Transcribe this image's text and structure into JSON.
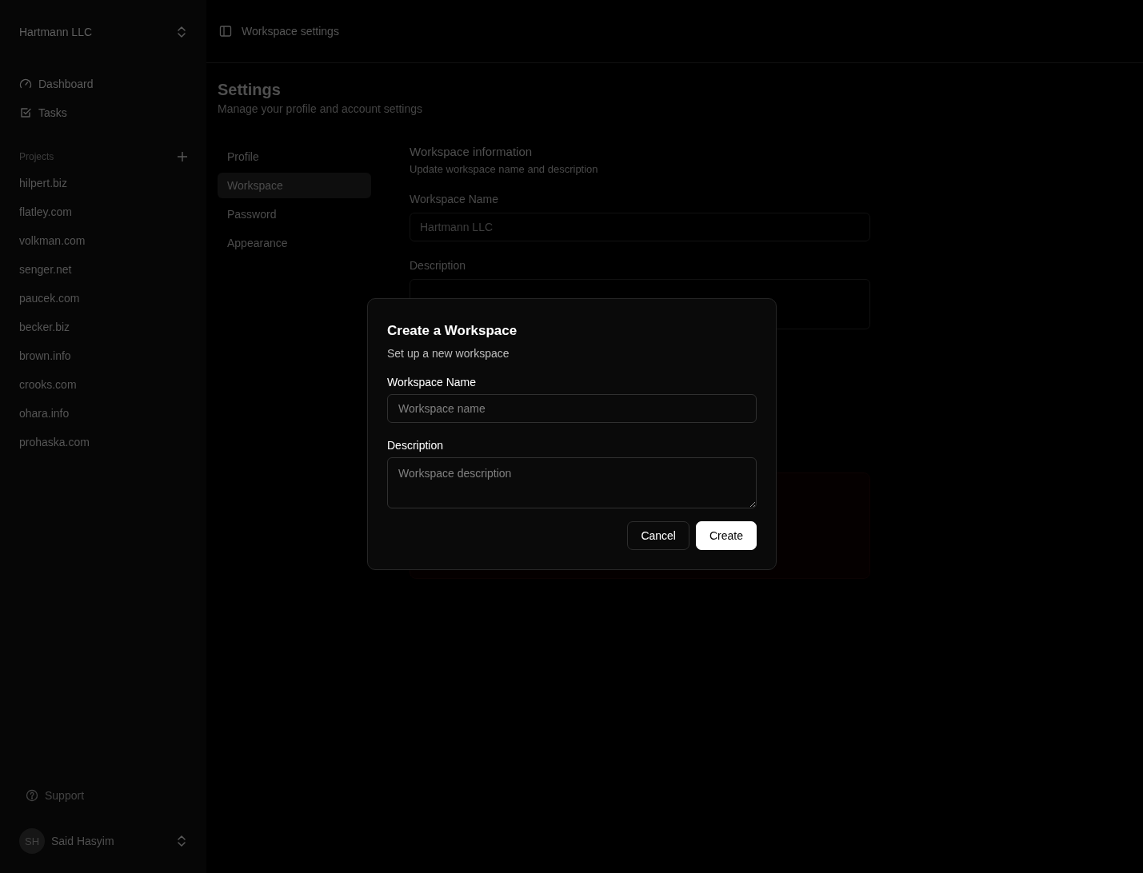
{
  "sidebar": {
    "workspace": {
      "name": "Hartmann LLC"
    },
    "nav": [
      {
        "kind": "dashboard",
        "label": "Dashboard"
      },
      {
        "kind": "tasks",
        "label": "Tasks"
      }
    ],
    "projects": {
      "title": "Projects",
      "items": [
        "hilpert.biz",
        "flatley.com",
        "volkman.com",
        "senger.net",
        "paucek.com",
        "becker.biz",
        "brown.info",
        "crooks.com",
        "ohara.info",
        "prohaska.com"
      ]
    },
    "support": {
      "label": "Support"
    },
    "user": {
      "initials": "SH",
      "name": "Said Hasyim"
    }
  },
  "header": {
    "title": "Workspace settings"
  },
  "settings": {
    "title": "Settings",
    "subtitle": "Manage your profile and account settings",
    "tabs": [
      {
        "label": "Profile",
        "selected": false
      },
      {
        "label": "Workspace",
        "selected": true
      },
      {
        "label": "Password",
        "selected": false
      },
      {
        "label": "Appearance",
        "selected": false
      }
    ],
    "section": {
      "title": "Workspace information",
      "subtitle": "Update workspace name and description",
      "fields": [
        {
          "kind": "input",
          "label": "Workspace Name",
          "value": "Hartmann LLC"
        },
        {
          "kind": "textarea",
          "label": "Description"
        }
      ]
    }
  },
  "dialog": {
    "title": "Create a Workspace",
    "subtitle": "Set up a new workspace",
    "fields": [
      {
        "kind": "input",
        "label": "Workspace Name",
        "placeholder": "Workspace name"
      },
      {
        "kind": "textarea",
        "label": "Description",
        "placeholder": "Workspace description"
      }
    ],
    "buttons": [
      {
        "kind": "secondary",
        "label": "Cancel"
      },
      {
        "kind": "primary",
        "label": "Create"
      }
    ]
  }
}
